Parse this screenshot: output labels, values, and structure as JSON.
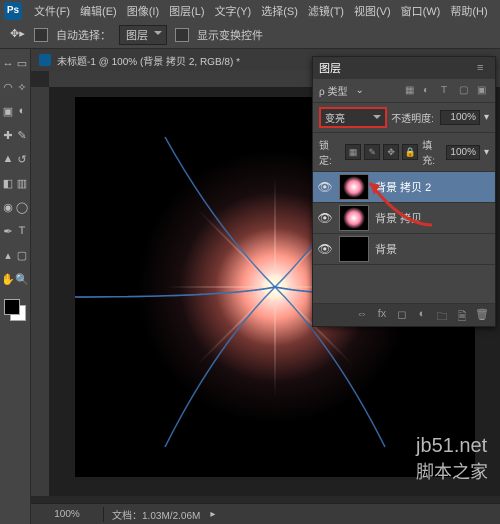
{
  "menubar": {
    "items": [
      "文件(F)",
      "编辑(E)",
      "图像(I)",
      "图层(L)",
      "文字(Y)",
      "选择(S)",
      "滤镜(T)",
      "视图(V)",
      "窗口(W)",
      "帮助(H)"
    ]
  },
  "optbar": {
    "auto_select": "自动选择：",
    "target": "图层",
    "show_transform": "显示变换控件"
  },
  "doc_tab": "未标题-1 @ 100% (背景 拷贝 2, RGB/8) *",
  "status": {
    "zoom": "100%",
    "doc": "文档：1.03M/2.06M"
  },
  "layers_panel": {
    "title": "图层",
    "kind_label": "ρ 类型",
    "blend_highlight": "变亮",
    "opacity_label": "不透明度:",
    "opacity_value": "100%",
    "lock_label": "锁定:",
    "fill_label": "填充:",
    "fill_value": "100%",
    "layers": [
      {
        "name": "背景 拷贝 2",
        "selected": true,
        "flare": true
      },
      {
        "name": "背景 拷贝",
        "selected": false,
        "flare": true
      },
      {
        "name": "背景",
        "selected": false,
        "flare": false
      }
    ]
  },
  "watermark": {
    "url": "jb51.net",
    "cn": "脚本之家"
  },
  "colors": {
    "highlight_box": "#d3302a",
    "arrow": "#d3302a",
    "layer_sel": "#5b7aa0"
  }
}
